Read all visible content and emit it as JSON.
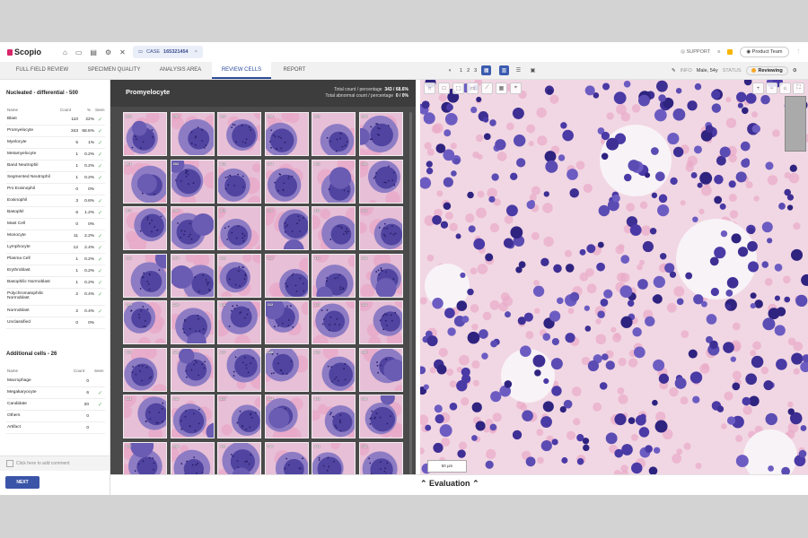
{
  "app": {
    "name": "Scopio",
    "case_label": "CASE",
    "case_number": "165321454"
  },
  "topbar_right": {
    "support": "SUPPORT",
    "user": "Product Team"
  },
  "tabs": [
    "FULL FIELD REVIEW",
    "SPECIMEN QUALITY",
    "ANALYSIS AREA",
    "REVIEW CELLS",
    "REPORT"
  ],
  "active_tab": "REVIEW CELLS",
  "layout_selector": [
    "1",
    "2",
    "3"
  ],
  "patient": {
    "label": "INFO",
    "value": "Male, 54y",
    "status_label": "STATUS",
    "status": "Reviewing"
  },
  "nucleated": {
    "title": "Nucleated - differential - 500",
    "headers": {
      "name": "Name",
      "count": "Count",
      "pct": "%",
      "seen": "Seen"
    },
    "rows": [
      {
        "name": "Blast",
        "count": "110",
        "pct": "22%",
        "seen": "✓"
      },
      {
        "name": "Promyelocyte",
        "count": "343",
        "pct": "68.6%",
        "seen": "✓"
      },
      {
        "name": "Myelocyte",
        "count": "5",
        "pct": "1%",
        "seen": "✓"
      },
      {
        "name": "Metamyelocyte",
        "count": "1",
        "pct": "0.2%",
        "seen": "✓"
      },
      {
        "name": "Band Neutrophil",
        "count": "1",
        "pct": "0.2%",
        "seen": "✓"
      },
      {
        "name": "Segmented Neutrophil",
        "count": "1",
        "pct": "0.2%",
        "seen": "✓"
      },
      {
        "name": "Pro Eosinophil",
        "count": "0",
        "pct": "0%",
        "seen": ""
      },
      {
        "name": "Eosinophil",
        "count": "3",
        "pct": "0.6%",
        "seen": "✓"
      },
      {
        "name": "Basophil",
        "count": "6",
        "pct": "1.2%",
        "seen": "✓"
      },
      {
        "name": "Mast Cell",
        "count": "0",
        "pct": "0%",
        "seen": ""
      },
      {
        "name": "Monocyte",
        "count": "11",
        "pct": "2.2%",
        "seen": "✓"
      },
      {
        "name": "Lymphocyte",
        "count": "12",
        "pct": "2.4%",
        "seen": "✓"
      },
      {
        "name": "Plasma Cell",
        "count": "1",
        "pct": "0.2%",
        "seen": "✓"
      },
      {
        "name": "Erythroblast",
        "count": "1",
        "pct": "0.2%",
        "seen": "✓"
      },
      {
        "name": "Basophilic Normoblast",
        "count": "1",
        "pct": "0.2%",
        "seen": "✓"
      },
      {
        "name": "Polychromatophilic Normoblast",
        "count": "2",
        "pct": "0.4%",
        "seen": "✓"
      },
      {
        "name": "Normoblast",
        "count": "2",
        "pct": "0.4%",
        "seen": "✓"
      },
      {
        "name": "Unclassified",
        "count": "0",
        "pct": "0%",
        "seen": ""
      }
    ]
  },
  "additional": {
    "title": "Additional cells - 26",
    "headers": {
      "name": "Name",
      "count": "Count",
      "seen": "Seen"
    },
    "rows": [
      {
        "name": "Macrophage",
        "count": "0",
        "seen": ""
      },
      {
        "name": "Megakaryocyte",
        "count": "6",
        "seen": "✓"
      },
      {
        "name": "Candidate",
        "count": "20",
        "seen": "✓"
      },
      {
        "name": "Others",
        "count": "0",
        "seen": ""
      },
      {
        "name": "Artifact",
        "count": "0",
        "seen": ""
      }
    ]
  },
  "comment_placeholder": "Click here to add comment",
  "next_label": "NEXT",
  "gallery": {
    "title": "Promyelocyte",
    "total_label": "Total count / percentage",
    "total_value": "343 / 68.6%",
    "abnormal_label": "Total abnormal count / percentage",
    "abnormal_value": "0 /    0%",
    "cell_labels": [
      "295",
      "296",
      "297",
      "298",
      "299",
      "300",
      "301",
      "302",
      "303",
      "304",
      "305",
      "306",
      "307",
      "308",
      "309",
      "310",
      "311",
      "312",
      "313",
      "314",
      "315",
      "316",
      "317",
      "318",
      "319",
      "320",
      "321",
      "322",
      "323",
      "324",
      "325",
      "326",
      "327",
      "328",
      "329",
      "330",
      "331",
      "332",
      "333",
      "334",
      "335",
      "336",
      "337",
      "338",
      "339",
      "340",
      "341",
      "342"
    ]
  },
  "evaluation_label": "Evaluation",
  "viewer": {
    "scale_label": "50 µm"
  },
  "colors": {
    "accent": "#3a54a8",
    "status_dot": "#f5a623",
    "check": "#5aa86b",
    "brand": "#d8266a"
  }
}
